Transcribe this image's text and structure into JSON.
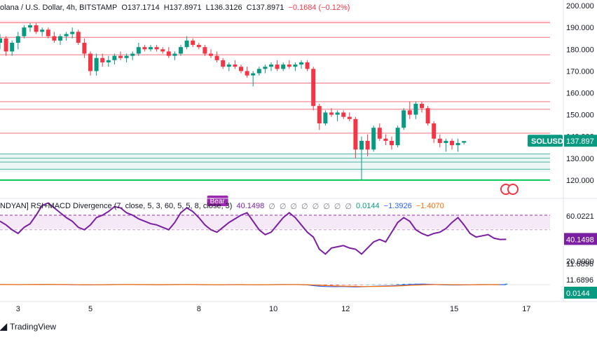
{
  "header": {
    "symbol_text": "olana / U.S. Dollar, 4h, BITSTAMP",
    "open": "O137.1714",
    "high": "H137.8971",
    "low": "L136.3126",
    "close": "C137.8971",
    "change": "−0.1684 (−0.12%)"
  },
  "indicator": {
    "name": "NDYAN] RSI+MACD Divergence (7, close, 5, 3, 60, 5, 5, 8, close, 3)",
    "values": [
      "40.1498",
      "∅",
      "∅",
      "∅",
      "∅",
      "∅",
      "∅",
      "∅",
      "∅",
      "0.0144",
      "−1.3926",
      "−1.4070"
    ],
    "value_colors": [
      "#7b1fa2",
      "#787b86",
      "#787b86",
      "#787b86",
      "#787b86",
      "#787b86",
      "#787b86",
      "#787b86",
      "#787b86",
      "#089981",
      "#2962ff",
      "#ff6d00"
    ]
  },
  "branding": {
    "logo_text": "TradingView"
  },
  "badges": {
    "price_label": "SOLUSD",
    "price_value": "137.897",
    "rsi_value": "40.1498",
    "macd_value": "0.0144",
    "bear": "Bear"
  },
  "chart_data": {
    "type": "candlestick",
    "x_ticks": [
      {
        "label": "3",
        "i": 3
      },
      {
        "label": "5",
        "i": 15
      },
      {
        "label": "8",
        "i": 33
      },
      {
        "label": "10",
        "i": 45
      },
      {
        "label": "12",
        "i": 57
      },
      {
        "label": "15",
        "i": 75
      },
      {
        "label": "17",
        "i": 87
      }
    ],
    "y_axis": {
      "ticks": [
        "200.000",
        "190.000",
        "180.000",
        "170.000",
        "160.000",
        "150.000",
        "140.000",
        "130.000",
        "120.000"
      ],
      "range": [
        119,
        201
      ]
    },
    "candles": [
      {
        "o": 183,
        "h": 187,
        "l": 180,
        "c": 185
      },
      {
        "o": 185,
        "h": 186,
        "l": 177,
        "c": 179
      },
      {
        "o": 179,
        "h": 184,
        "l": 177,
        "c": 183
      },
      {
        "o": 183,
        "h": 188,
        "l": 180,
        "c": 186
      },
      {
        "o": 186,
        "h": 191,
        "l": 185,
        "c": 190
      },
      {
        "o": 190,
        "h": 192,
        "l": 188,
        "c": 191
      },
      {
        "o": 191,
        "h": 192,
        "l": 187,
        "c": 188
      },
      {
        "o": 188,
        "h": 190,
        "l": 186,
        "c": 189
      },
      {
        "o": 189,
        "h": 190,
        "l": 185,
        "c": 186
      },
      {
        "o": 186,
        "h": 188,
        "l": 183,
        "c": 184
      },
      {
        "o": 184,
        "h": 187,
        "l": 182,
        "c": 186
      },
      {
        "o": 186,
        "h": 188,
        "l": 184,
        "c": 187
      },
      {
        "o": 187,
        "h": 190,
        "l": 185,
        "c": 188
      },
      {
        "o": 188,
        "h": 189,
        "l": 182,
        "c": 183
      },
      {
        "o": 183,
        "h": 185,
        "l": 176,
        "c": 178
      },
      {
        "o": 178,
        "h": 179,
        "l": 168,
        "c": 170
      },
      {
        "o": 170,
        "h": 178,
        "l": 168,
        "c": 176
      },
      {
        "o": 176,
        "h": 178,
        "l": 172,
        "c": 174
      },
      {
        "o": 174,
        "h": 177,
        "l": 172,
        "c": 175
      },
      {
        "o": 175,
        "h": 178,
        "l": 173,
        "c": 177
      },
      {
        "o": 177,
        "h": 179,
        "l": 175,
        "c": 176
      },
      {
        "o": 176,
        "h": 178,
        "l": 174,
        "c": 177
      },
      {
        "o": 177,
        "h": 179,
        "l": 175,
        "c": 178
      },
      {
        "o": 178,
        "h": 183,
        "l": 177,
        "c": 181
      },
      {
        "o": 181,
        "h": 182,
        "l": 179,
        "c": 180
      },
      {
        "o": 180,
        "h": 182,
        "l": 179,
        "c": 181
      },
      {
        "o": 181,
        "h": 182,
        "l": 179,
        "c": 180
      },
      {
        "o": 180,
        "h": 181,
        "l": 178,
        "c": 179
      },
      {
        "o": 179,
        "h": 181,
        "l": 176,
        "c": 177
      },
      {
        "o": 177,
        "h": 179,
        "l": 175,
        "c": 178
      },
      {
        "o": 178,
        "h": 182,
        "l": 177,
        "c": 181
      },
      {
        "o": 181,
        "h": 186,
        "l": 180,
        "c": 184
      },
      {
        "o": 184,
        "h": 185,
        "l": 181,
        "c": 182
      },
      {
        "o": 182,
        "h": 183,
        "l": 180,
        "c": 181
      },
      {
        "o": 181,
        "h": 182,
        "l": 177,
        "c": 178
      },
      {
        "o": 178,
        "h": 180,
        "l": 176,
        "c": 177
      },
      {
        "o": 177,
        "h": 179,
        "l": 174,
        "c": 175
      },
      {
        "o": 175,
        "h": 176,
        "l": 171,
        "c": 172
      },
      {
        "o": 172,
        "h": 174,
        "l": 170,
        "c": 173
      },
      {
        "o": 173,
        "h": 175,
        "l": 171,
        "c": 172
      },
      {
        "o": 172,
        "h": 173,
        "l": 169,
        "c": 170
      },
      {
        "o": 170,
        "h": 172,
        "l": 167,
        "c": 168
      },
      {
        "o": 168,
        "h": 170,
        "l": 163,
        "c": 169
      },
      {
        "o": 169,
        "h": 172,
        "l": 168,
        "c": 171
      },
      {
        "o": 171,
        "h": 173,
        "l": 169,
        "c": 172
      },
      {
        "o": 172,
        "h": 174,
        "l": 170,
        "c": 173
      },
      {
        "o": 173,
        "h": 175,
        "l": 170,
        "c": 171
      },
      {
        "o": 171,
        "h": 174,
        "l": 170,
        "c": 173
      },
      {
        "o": 173,
        "h": 175,
        "l": 171,
        "c": 172
      },
      {
        "o": 172,
        "h": 174,
        "l": 170,
        "c": 173
      },
      {
        "o": 173,
        "h": 175,
        "l": 171,
        "c": 174
      },
      {
        "o": 174,
        "h": 175,
        "l": 170,
        "c": 171
      },
      {
        "o": 171,
        "h": 172,
        "l": 152,
        "c": 154
      },
      {
        "o": 154,
        "h": 155,
        "l": 143,
        "c": 146
      },
      {
        "o": 146,
        "h": 152,
        "l": 145,
        "c": 151
      },
      {
        "o": 151,
        "h": 153,
        "l": 149,
        "c": 150
      },
      {
        "o": 150,
        "h": 152,
        "l": 147,
        "c": 151
      },
      {
        "o": 151,
        "h": 152,
        "l": 148,
        "c": 149
      },
      {
        "o": 149,
        "h": 151,
        "l": 147,
        "c": 148
      },
      {
        "o": 148,
        "h": 149,
        "l": 130,
        "c": 134
      },
      {
        "o": 134,
        "h": 140,
        "l": 120,
        "c": 138
      },
      {
        "o": 138,
        "h": 141,
        "l": 131,
        "c": 134
      },
      {
        "o": 134,
        "h": 145,
        "l": 133,
        "c": 144
      },
      {
        "o": 144,
        "h": 146,
        "l": 138,
        "c": 139
      },
      {
        "o": 139,
        "h": 141,
        "l": 136,
        "c": 138
      },
      {
        "o": 138,
        "h": 140,
        "l": 134,
        "c": 136
      },
      {
        "o": 136,
        "h": 145,
        "l": 135,
        "c": 144
      },
      {
        "o": 144,
        "h": 153,
        "l": 143,
        "c": 152
      },
      {
        "o": 152,
        "h": 156,
        "l": 148,
        "c": 150
      },
      {
        "o": 150,
        "h": 156,
        "l": 148,
        "c": 155
      },
      {
        "o": 155,
        "h": 156,
        "l": 151,
        "c": 153
      },
      {
        "o": 153,
        "h": 154,
        "l": 145,
        "c": 146
      },
      {
        "o": 146,
        "h": 147,
        "l": 137,
        "c": 139
      },
      {
        "o": 139,
        "h": 141,
        "l": 135,
        "c": 137
      },
      {
        "o": 137,
        "h": 139,
        "l": 133,
        "c": 138
      },
      {
        "o": 138,
        "h": 139,
        "l": 134,
        "c": 136
      },
      {
        "o": 136,
        "h": 139,
        "l": 133,
        "c": 137
      },
      {
        "o": 137.17,
        "h": 137.9,
        "l": 136.31,
        "c": 137.9
      }
    ],
    "horizontal_levels": [
      {
        "price": 192.2,
        "color": "#f23645",
        "fill": true
      },
      {
        "price": 185.5,
        "color": "#f23645"
      },
      {
        "price": 177.5,
        "color": "#f23645"
      },
      {
        "price": 164.5,
        "color": "#f23645"
      },
      {
        "price": 156.0,
        "color": "#f23645"
      },
      {
        "price": 152.5,
        "color": "#f23645"
      },
      {
        "price": 141.5,
        "color": "#f23645"
      },
      {
        "price": 132.0,
        "color": "#089981",
        "fill": true
      },
      {
        "price": 130.0,
        "color": "#089981"
      },
      {
        "price": 128.3,
        "color": "#089981"
      },
      {
        "price": 125.0,
        "color": "#089981"
      },
      {
        "price": 120.0,
        "color": "#00c853",
        "bold": true
      }
    ],
    "rsi": {
      "axis_ticks": [
        "60.0221",
        "20.0000",
        "11.6896"
      ],
      "upper": 60,
      "lower": 20,
      "last": "40.1498",
      "values": [
        55,
        52,
        48,
        45,
        50,
        53,
        60,
        68,
        70,
        66,
        62,
        58,
        55,
        50,
        48,
        52,
        58,
        60,
        63,
        67,
        66,
        62,
        60,
        57,
        55,
        53,
        52,
        50,
        48,
        54,
        62,
        66,
        63,
        58,
        52,
        48,
        46,
        50,
        54,
        57,
        60,
        62,
        55,
        48,
        44,
        46,
        52,
        58,
        62,
        58,
        52,
        46,
        42,
        32,
        28,
        33,
        34,
        35,
        33,
        32,
        28,
        33,
        38,
        40,
        38,
        46,
        54,
        58,
        55,
        48,
        45,
        43,
        45,
        46,
        49,
        54,
        58,
        52,
        45,
        42,
        43,
        44,
        41,
        40,
        40.15
      ]
    },
    "macd": {
      "last": "0.0144",
      "line": [
        0.2,
        0.1,
        0.05,
        0,
        0.1,
        0.2,
        0.25,
        0.3,
        0.3,
        0.2,
        0.1,
        0,
        -0.1,
        -0.2,
        -0.3,
        -0.3,
        -0.2,
        -0.1,
        0,
        0.1,
        0.2,
        0.2,
        0.1,
        0,
        0,
        0,
        -0.1,
        -0.1,
        0,
        0.1,
        0.2,
        0.2,
        0.1,
        0,
        -0.1,
        -0.2,
        -0.2,
        -0.1,
        0,
        0,
        0,
        -0.1,
        -0.2,
        -0.2,
        -0.1,
        0,
        0.1,
        0.1,
        0.2,
        0.1,
        0,
        -0.5,
        -1.5,
        -2.5,
        -3,
        -3.2,
        -3.2,
        -3,
        -3.3,
        -3.6,
        -3.4,
        -3,
        -2.6,
        -2.4,
        -2.1,
        -1.8,
        -1.2,
        -0.5,
        0.2,
        0.6,
        0.8,
        0.6,
        0.3,
        -0.1,
        -0.4,
        -0.6,
        -0.6,
        -0.4,
        -0.2,
        0,
        0.1,
        0.1,
        0,
        -0.02,
        0.014
      ],
      "signal": [
        0.1,
        0.1,
        0.1,
        0.05,
        0.05,
        0.1,
        0.15,
        0.2,
        0.25,
        0.25,
        0.2,
        0.15,
        0.05,
        -0.05,
        -0.15,
        -0.2,
        -0.2,
        -0.15,
        -0.1,
        0,
        0.05,
        0.1,
        0.12,
        0.1,
        0.05,
        0.03,
        0,
        -0.03,
        -0.03,
        0,
        0.05,
        0.1,
        0.1,
        0.07,
        0.03,
        -0.05,
        -0.1,
        -0.1,
        -0.07,
        -0.05,
        -0.03,
        -0.05,
        -0.08,
        -0.12,
        -0.12,
        -0.1,
        -0.05,
        0,
        0.05,
        0.05,
        0.03,
        -0.1,
        -0.5,
        -1,
        -1.5,
        -1.9,
        -2.2,
        -2.4,
        -2.6,
        -2.8,
        -3,
        -3,
        -2.9,
        -2.8,
        -2.6,
        -2.4,
        -2.1,
        -1.7,
        -1.2,
        -0.8,
        -0.4,
        -0.1,
        0.05,
        0.1,
        0.05,
        -0.05,
        -0.15,
        -0.2,
        -0.2,
        -0.15,
        -0.1,
        -0.05,
        -0.03,
        -0.02,
        -1.407
      ]
    }
  }
}
